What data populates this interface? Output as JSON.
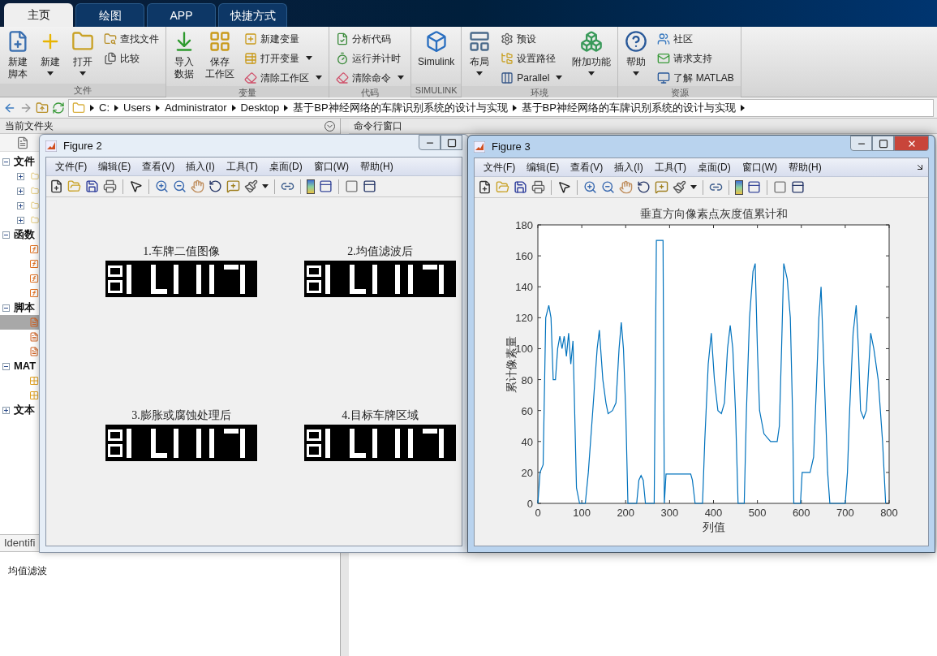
{
  "tabs": [
    {
      "label": "主页",
      "selected": true
    },
    {
      "label": "绘图",
      "selected": false
    },
    {
      "label": "APP",
      "selected": false
    },
    {
      "label": "快捷方式",
      "selected": false
    }
  ],
  "ribbon": {
    "groups": [
      {
        "label": "文件",
        "items": [
          {
            "kind": "large",
            "lines": [
              "新建",
              "脚本"
            ],
            "dropdown": false
          },
          {
            "kind": "large",
            "lines": [
              "新建"
            ],
            "dropdown": true
          },
          {
            "kind": "large",
            "lines": [
              "打开"
            ],
            "dropdown": true
          },
          {
            "kind": "column",
            "entries": [
              {
                "label": "查找文件",
                "dropdown": false
              },
              {
                "label": "比较",
                "dropdown": false
              }
            ]
          }
        ]
      },
      {
        "label": "变量",
        "items": [
          {
            "kind": "large",
            "lines": [
              "导入",
              "数据"
            ],
            "dropdown": false
          },
          {
            "kind": "large",
            "lines": [
              "保存",
              "工作区"
            ],
            "dropdown": false
          },
          {
            "kind": "column",
            "entries": [
              {
                "label": "新建变量",
                "dropdown": false
              },
              {
                "label": "打开变量",
                "dropdown": true
              },
              {
                "label": "清除工作区",
                "dropdown": true
              }
            ]
          }
        ]
      },
      {
        "label": "代码",
        "items": [
          {
            "kind": "column",
            "entries": [
              {
                "label": "分析代码",
                "dropdown": false
              },
              {
                "label": "运行并计时",
                "dropdown": false
              },
              {
                "label": "清除命令",
                "dropdown": true
              }
            ]
          }
        ]
      },
      {
        "label": "SIMULINK",
        "items": [
          {
            "kind": "large",
            "lines": [
              "Simulink"
            ],
            "dropdown": false
          }
        ]
      },
      {
        "label": "环境",
        "items": [
          {
            "kind": "large",
            "lines": [
              "布局"
            ],
            "dropdown": true
          },
          {
            "kind": "column",
            "entries": [
              {
                "label": "预设",
                "dropdown": false
              },
              {
                "label": "设置路径",
                "dropdown": false
              },
              {
                "label": "Parallel",
                "dropdown": true
              }
            ]
          },
          {
            "kind": "large",
            "lines": [
              "附加功能"
            ],
            "dropdown": true
          }
        ]
      },
      {
        "label": "资源",
        "items": [
          {
            "kind": "large",
            "lines": [
              "帮助"
            ],
            "dropdown": true
          },
          {
            "kind": "column",
            "entries": [
              {
                "label": "社区",
                "dropdown": false
              },
              {
                "label": "请求支持",
                "dropdown": false
              },
              {
                "label": "了解 MATLAB",
                "dropdown": false
              }
            ]
          }
        ]
      }
    ]
  },
  "address": {
    "segments": [
      "C:",
      "Users",
      "Administrator",
      "Desktop",
      "基于BP神经网络的车牌识别系统的设计与实现",
      "基于BP神经网络的车牌识别系统的设计与实现"
    ]
  },
  "current_folder": {
    "title": "当前文件夹",
    "tree": [
      {
        "label": "文件",
        "expanded": true,
        "children": [
          {
            "kind": "folder",
            "expanded": false,
            "selected": false
          },
          {
            "kind": "folder",
            "expanded": false,
            "selected": false
          },
          {
            "kind": "folder",
            "expanded": false,
            "selected": false
          },
          {
            "kind": "folder",
            "expanded": false,
            "selected": false
          }
        ]
      },
      {
        "label": "函数",
        "expanded": true,
        "children": [
          {
            "kind": "function",
            "selected": false
          },
          {
            "kind": "function",
            "selected": false
          },
          {
            "kind": "function",
            "selected": false
          },
          {
            "kind": "function",
            "selected": false
          }
        ]
      },
      {
        "label": "脚本",
        "expanded": true,
        "children": [
          {
            "kind": "script",
            "selected": true
          },
          {
            "kind": "script",
            "selected": false
          },
          {
            "kind": "script",
            "selected": false
          }
        ]
      },
      {
        "label": "MAT",
        "expanded": true,
        "children": [
          {
            "kind": "mat",
            "selected": false
          },
          {
            "kind": "mat",
            "selected": false
          }
        ]
      },
      {
        "label": "文本",
        "expanded": false
      }
    ],
    "details_header": "Identifi",
    "details_text": "均值滤波"
  },
  "command_window": {
    "title": "命令行窗口"
  },
  "figures": [
    {
      "title": "Figure 2",
      "active": false,
      "buttons": [
        {
          "kind": "minimize"
        },
        {
          "kind": "maximize"
        }
      ],
      "undock_icon": false,
      "menu": [
        "文件(F)",
        "编辑(E)",
        "查看(V)",
        "插入(I)",
        "工具(T)",
        "桌面(D)",
        "窗口(W)",
        "帮助(H)"
      ],
      "content": {
        "kind": "images",
        "subplots": [
          {
            "title": "1.车牌二值图像",
            "kind": "picture"
          },
          {
            "title": "2.均值滤波后",
            "kind": "picture"
          },
          {
            "title": "3.膨胀或腐蚀处理后",
            "kind": "picture"
          },
          {
            "title": "4.目标车牌区域",
            "kind": "picture"
          }
        ]
      }
    },
    {
      "title": "Figure 3",
      "active": true,
      "buttons": [
        {
          "kind": "minimize"
        },
        {
          "kind": "maximize"
        },
        {
          "kind": "close"
        }
      ],
      "undock_icon": true,
      "menu": [
        "文件(F)",
        "编辑(E)",
        "查看(V)",
        "插入(I)",
        "工具(T)",
        "桌面(D)",
        "窗口(W)",
        "帮助(H)"
      ],
      "content": {
        "kind": "chart",
        "chart_data": {
          "type": "line",
          "title": "垂直方向像素点灰度值累计和",
          "xlabel": "列值",
          "ylabel": "累计像素量",
          "xlim": [
            0,
            800
          ],
          "ylim": [
            0,
            180
          ],
          "xticks": [
            0,
            100,
            200,
            300,
            400,
            500,
            600,
            700,
            800
          ],
          "yticks": [
            0,
            20,
            40,
            60,
            80,
            100,
            120,
            140,
            160,
            180
          ],
          "x": [
            0,
            5,
            12,
            18,
            25,
            30,
            35,
            40,
            45,
            50,
            55,
            60,
            65,
            70,
            75,
            80,
            88,
            95,
            108,
            115,
            125,
            135,
            140,
            148,
            155,
            160,
            170,
            178,
            185,
            190,
            195,
            200,
            205,
            225,
            230,
            235,
            240,
            245,
            265,
            270,
            285,
            288,
            292,
            348,
            352,
            358,
            375,
            380,
            388,
            395,
            402,
            410,
            418,
            425,
            432,
            438,
            444,
            450,
            456,
            470,
            475,
            482,
            490,
            495,
            500,
            505,
            515,
            530,
            545,
            550,
            555,
            560,
            568,
            575,
            580,
            583,
            598,
            602,
            620,
            628,
            635,
            640,
            645,
            650,
            655,
            660,
            665,
            700,
            705,
            710,
            718,
            725,
            730,
            735,
            742,
            748,
            752,
            758,
            765,
            775,
            785,
            792
          ],
          "series": [
            {
              "color": "#0072bd",
              "values": [
                0,
                20,
                25,
                120,
                128,
                120,
                80,
                80,
                100,
                108,
                100,
                108,
                95,
                110,
                90,
                105,
                10,
                0,
                0,
                20,
                60,
                100,
                112,
                80,
                65,
                58,
                60,
                65,
                100,
                117,
                100,
                60,
                0,
                0,
                15,
                18,
                15,
                0,
                0,
                170,
                170,
                0,
                19,
                19,
                15,
                0,
                0,
                40,
                90,
                110,
                80,
                60,
                58,
                65,
                100,
                115,
                100,
                60,
                0,
                0,
                60,
                120,
                150,
                155,
                100,
                60,
                45,
                40,
                40,
                50,
                100,
                155,
                145,
                120,
                60,
                0,
                0,
                20,
                20,
                30,
                80,
                120,
                140,
                100,
                60,
                20,
                0,
                0,
                20,
                60,
                110,
                128,
                100,
                60,
                55,
                60,
                80,
                110,
                100,
                80,
                40,
                0
              ]
            }
          ]
        }
      }
    }
  ]
}
